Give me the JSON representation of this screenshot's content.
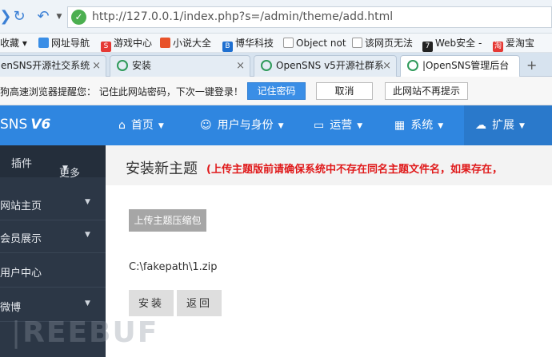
{
  "browser": {
    "url": "http://127.0.0.1/index.php?s=/admin/theme/add.html",
    "bookmarks": [
      {
        "label": "收藏 ▾",
        "color": ""
      },
      {
        "label": "网址导航",
        "color": "#3a8ee6"
      },
      {
        "label": "游戏中心",
        "color": "#e53935"
      },
      {
        "label": "小说大全",
        "color": "#e8532b"
      },
      {
        "label": "博华科技",
        "color": "#1e6fd0"
      },
      {
        "label": "Object not",
        "color": "#888888"
      },
      {
        "label": "该网页无法",
        "color": "#888888"
      },
      {
        "label": "Web安全 -",
        "color": "#222222"
      },
      {
        "label": "爱淘宝",
        "color": "#e53935"
      }
    ],
    "tabs": [
      {
        "label": "enSNS开源社交系统",
        "active": false
      },
      {
        "label": "安装",
        "active": false
      },
      {
        "label": "OpenSNS v5开源社群系",
        "active": false
      },
      {
        "label": "|OpenSNS管理后台",
        "active": true
      }
    ],
    "new_tab": "+",
    "password_prompt": {
      "message": "狗高速浏览器提醒您：  记住此网站密码，下次一键登录！",
      "remember": "记住密码",
      "cancel": "取消",
      "never": "此网站不再提示"
    }
  },
  "app": {
    "logo": "SNS",
    "logo_version": "V6",
    "nav": [
      {
        "label": "首页",
        "icon": "home-icon",
        "caret": true
      },
      {
        "label": "用户与身份",
        "icon": "user-icon",
        "caret": true
      },
      {
        "label": "运营",
        "icon": "monitor-icon",
        "caret": true
      },
      {
        "label": "系统",
        "icon": "windows-icon",
        "caret": true
      },
      {
        "label": "扩展",
        "icon": "cloud-icon",
        "caret": true
      }
    ],
    "sidebar": {
      "top": {
        "plugins": "插件",
        "more": "更多"
      },
      "items": [
        {
          "label": "网站主页"
        },
        {
          "label": "会员展示"
        },
        {
          "label": "用户中心"
        },
        {
          "label": "微博"
        }
      ]
    }
  },
  "main": {
    "title": "安装新主题",
    "warning": "(上传主题版前请确保系统中不存在同名主题文件名，如果存在，",
    "upload_label": "上传主题压缩包",
    "file_path": "C:\\fakepath\\1.zip",
    "install_label": "安装",
    "back_label": "返回"
  },
  "watermark": "REEBUF"
}
